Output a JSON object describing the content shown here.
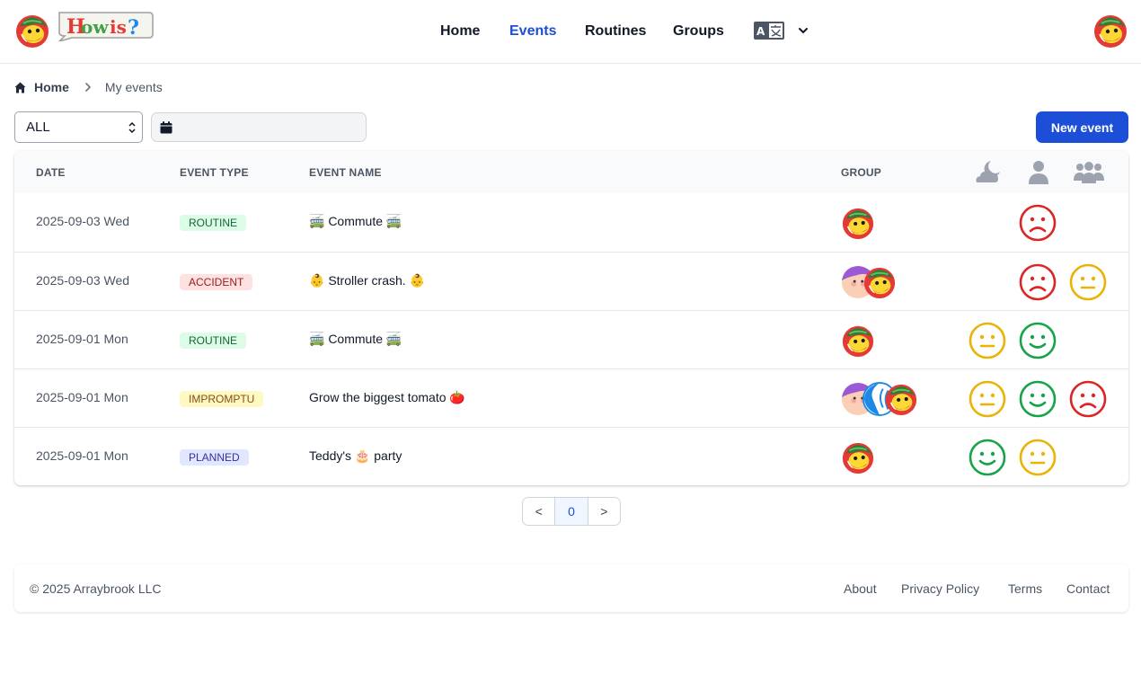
{
  "header": {
    "logo_text": "How is?",
    "nav": [
      {
        "label": "Home"
      },
      {
        "label": "Events"
      },
      {
        "label": "Routines"
      },
      {
        "label": "Groups"
      }
    ],
    "active_nav": "Events",
    "language_icon": "translate-icon"
  },
  "breadcrumb": {
    "home": "Home",
    "current": "My events"
  },
  "filters": {
    "type_value": "ALL",
    "date_placeholder": ""
  },
  "new_event_label": "New event",
  "table": {
    "headers": {
      "date": "DATE",
      "type": "EVENT TYPE",
      "name": "EVENT NAME",
      "group": "GROUP"
    },
    "mood_header_icons": [
      "moon-cloud-icon",
      "person-icon",
      "people-icon"
    ],
    "rows": [
      {
        "date": "2025-09-03 Wed",
        "type": "ROUTINE",
        "name": "🚎 Commute 🚎",
        "avatars": [
          "tomato"
        ],
        "moods": [
          null,
          "sad",
          null
        ]
      },
      {
        "date": "2025-09-03 Wed",
        "type": "ACCIDENT",
        "name": "👶 Stroller crash. 👶",
        "avatars": [
          "purple",
          "tomato"
        ],
        "moods": [
          null,
          "sad",
          "neutral"
        ]
      },
      {
        "date": "2025-09-01 Mon",
        "type": "ROUTINE",
        "name": "🚎 Commute 🚎",
        "avatars": [
          "tomato"
        ],
        "moods": [
          "neutral",
          "happy",
          null
        ]
      },
      {
        "date": "2025-09-01 Mon",
        "type": "IMPROMPTU",
        "name": "Grow the biggest tomato 🍅",
        "avatars": [
          "purple",
          "blue",
          "tomato"
        ],
        "moods": [
          "neutral",
          "happy",
          "sad"
        ]
      },
      {
        "date": "2025-09-01 Mon",
        "type": "PLANNED",
        "name": "Teddy's 🎂 party",
        "avatars": [
          "tomato"
        ],
        "moods": [
          "happy",
          "neutral",
          null
        ]
      }
    ]
  },
  "pagination": {
    "prev": "<",
    "current": "0",
    "next": ">"
  },
  "footer": {
    "copyright": "© 2025 Arraybrook LLC",
    "links": [
      "About",
      "Privacy Policy",
      "Terms",
      "Contact"
    ]
  },
  "colors": {
    "accent": "#1d4ed8",
    "happy": "#16a34a",
    "neutral": "#eab308",
    "sad": "#dc2626"
  }
}
